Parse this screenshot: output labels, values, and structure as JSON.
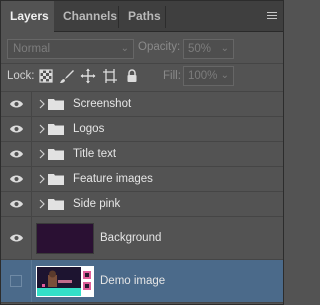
{
  "tabs": [
    {
      "label": "Layers",
      "active": true
    },
    {
      "label": "Channels",
      "active": false
    },
    {
      "label": "Paths",
      "active": false
    }
  ],
  "blend_mode": {
    "value": "Normal"
  },
  "opacity": {
    "label": "Opacity:",
    "value": "50%"
  },
  "lock": {
    "label": "Lock:",
    "icons": [
      "lock-transparent-pixels-icon",
      "lock-image-pixels-icon",
      "lock-position-icon",
      "lock-artboard-icon",
      "lock-all-icon"
    ]
  },
  "fill": {
    "label": "Fill:",
    "value": "100%"
  },
  "layers": [
    {
      "name": "Screenshot",
      "type": "group",
      "visible": true
    },
    {
      "name": "Logos",
      "type": "group",
      "visible": true
    },
    {
      "name": "Title text",
      "type": "group",
      "visible": true
    },
    {
      "name": "Feature images",
      "type": "group",
      "visible": true
    },
    {
      "name": "Side pink",
      "type": "group",
      "visible": true
    },
    {
      "name": "Background",
      "type": "layer",
      "visible": true,
      "thumb_color": "#2a1033"
    },
    {
      "name": "Demo image",
      "type": "layer",
      "visible": false,
      "selected": true
    }
  ],
  "colors": {
    "panel_bg": "#535353",
    "tab_bar": "#3f3f3f",
    "selection": "#4b6a8a"
  }
}
